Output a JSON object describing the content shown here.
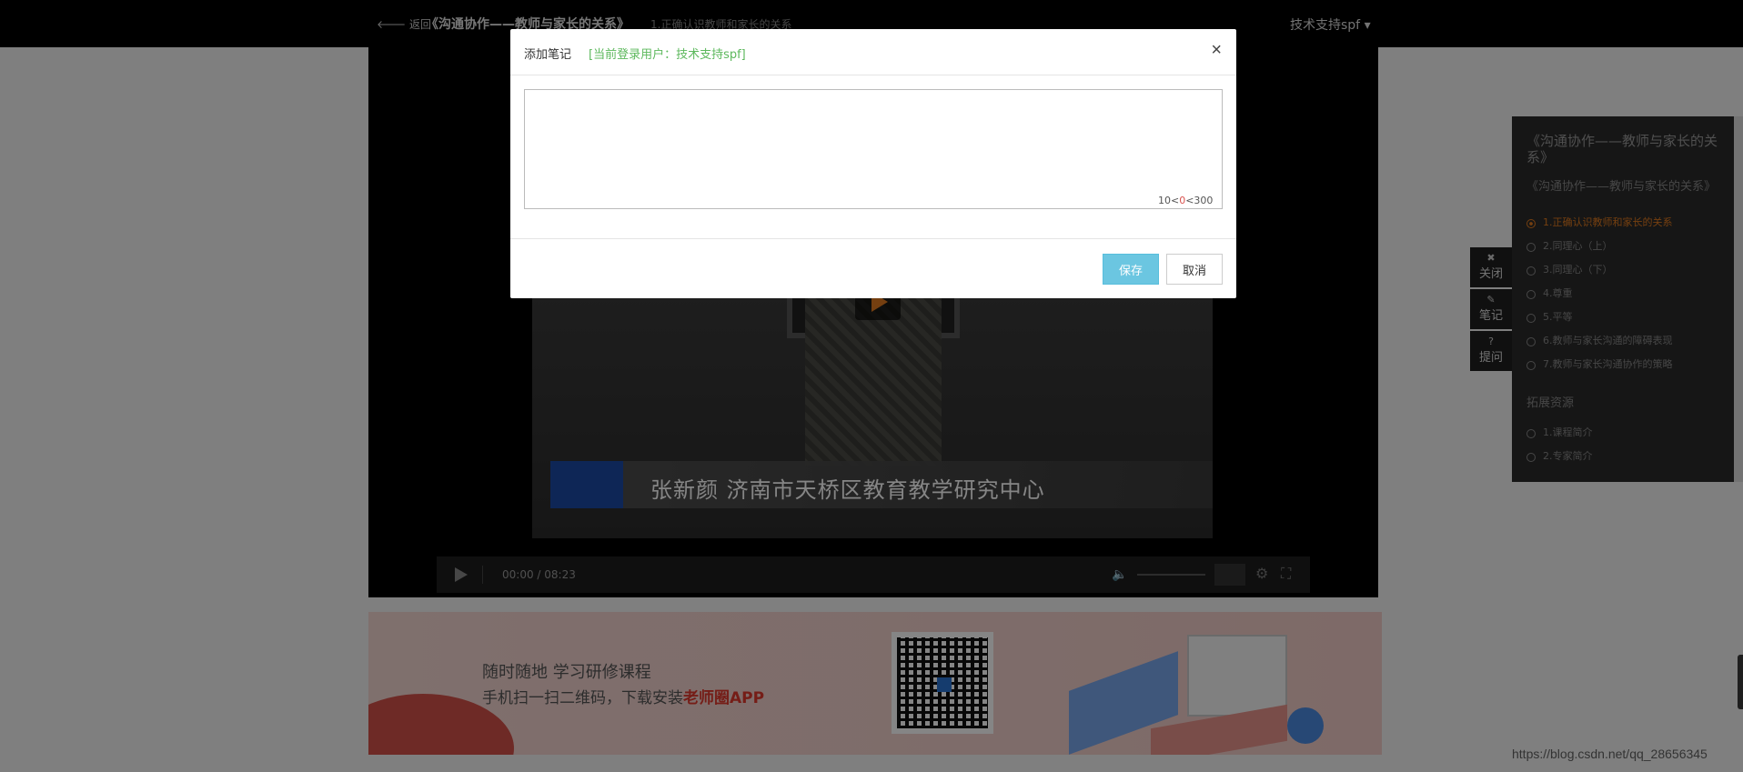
{
  "topbar": {
    "back_label": "返回",
    "course_title": "《沟通协作——教师与家长的关系》",
    "lesson_title": "1.正确认识教师和家长的关系",
    "user_menu": "技术支持spf"
  },
  "video": {
    "lower_third": "张新颜    济南市天桥区教育教学研究中心",
    "time": "00:00 / 08:23"
  },
  "side_tools": {
    "close": "关闭",
    "note": "笔记",
    "ask": "提问"
  },
  "catalog": {
    "title": "《沟通协作——教师与家长的关系》",
    "subtitle": "《沟通协作——教师与家长的关系》",
    "items": [
      "1.正确认识教师和家长的关系",
      "2.同理心（上）",
      "3.同理心（下）",
      "4.尊重",
      "5.平等",
      "6.教师与家长沟通的障碍表现",
      "7.教师与家长沟通协作的策略"
    ],
    "section": "拓展资源",
    "extra_items": [
      "1.课程简介",
      "2.专家简介"
    ]
  },
  "banner": {
    "line1": "随时随地    学习研修课程",
    "line2_prefix": "手机扫一扫二维码，下载安装",
    "line2_highlight": "老师圈APP"
  },
  "modal": {
    "title": "添加笔记",
    "user": "[当前登录用户：技术支持spf]",
    "textarea_value": "",
    "counter_min": "10<",
    "counter_cur": "0",
    "counter_max": "<300",
    "save_label": "保存",
    "cancel_label": "取消"
  },
  "watermark": "https://blog.csdn.net/qq_28656345",
  "colors": {
    "accent_orange": "#e07a1f",
    "save_blue": "#5bc0de",
    "user_green": "#5cb85c"
  }
}
